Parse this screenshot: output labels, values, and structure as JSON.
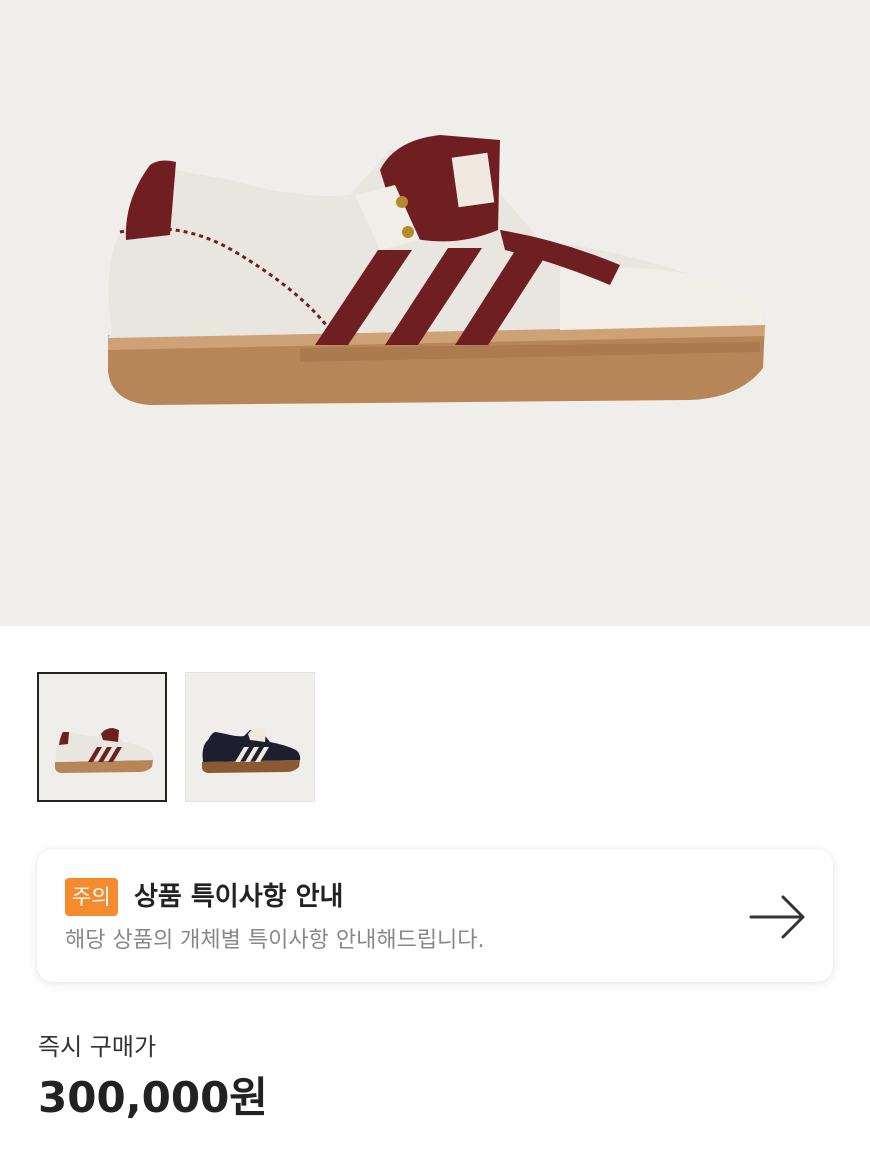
{
  "product": {
    "main_image": "sneaker-cream-burgundy",
    "colors": {
      "background": "#efeeea",
      "upper": "#e8e6df",
      "stripes": "#6f1e21",
      "gum_sole": "#b78658"
    }
  },
  "thumbnails": [
    {
      "name": "cream-burgundy",
      "selected": true
    },
    {
      "name": "black-cream",
      "selected": false
    }
  ],
  "notice": {
    "badge": "주의",
    "title": "상품 특이사항 안내",
    "description": "해당 상품의 개체별 특이사항 안내해드립니다.",
    "arrow_icon": "arrow-right-icon",
    "badge_color": "#f58b2d"
  },
  "price": {
    "label": "즉시 구매가",
    "value": "300,000원"
  }
}
